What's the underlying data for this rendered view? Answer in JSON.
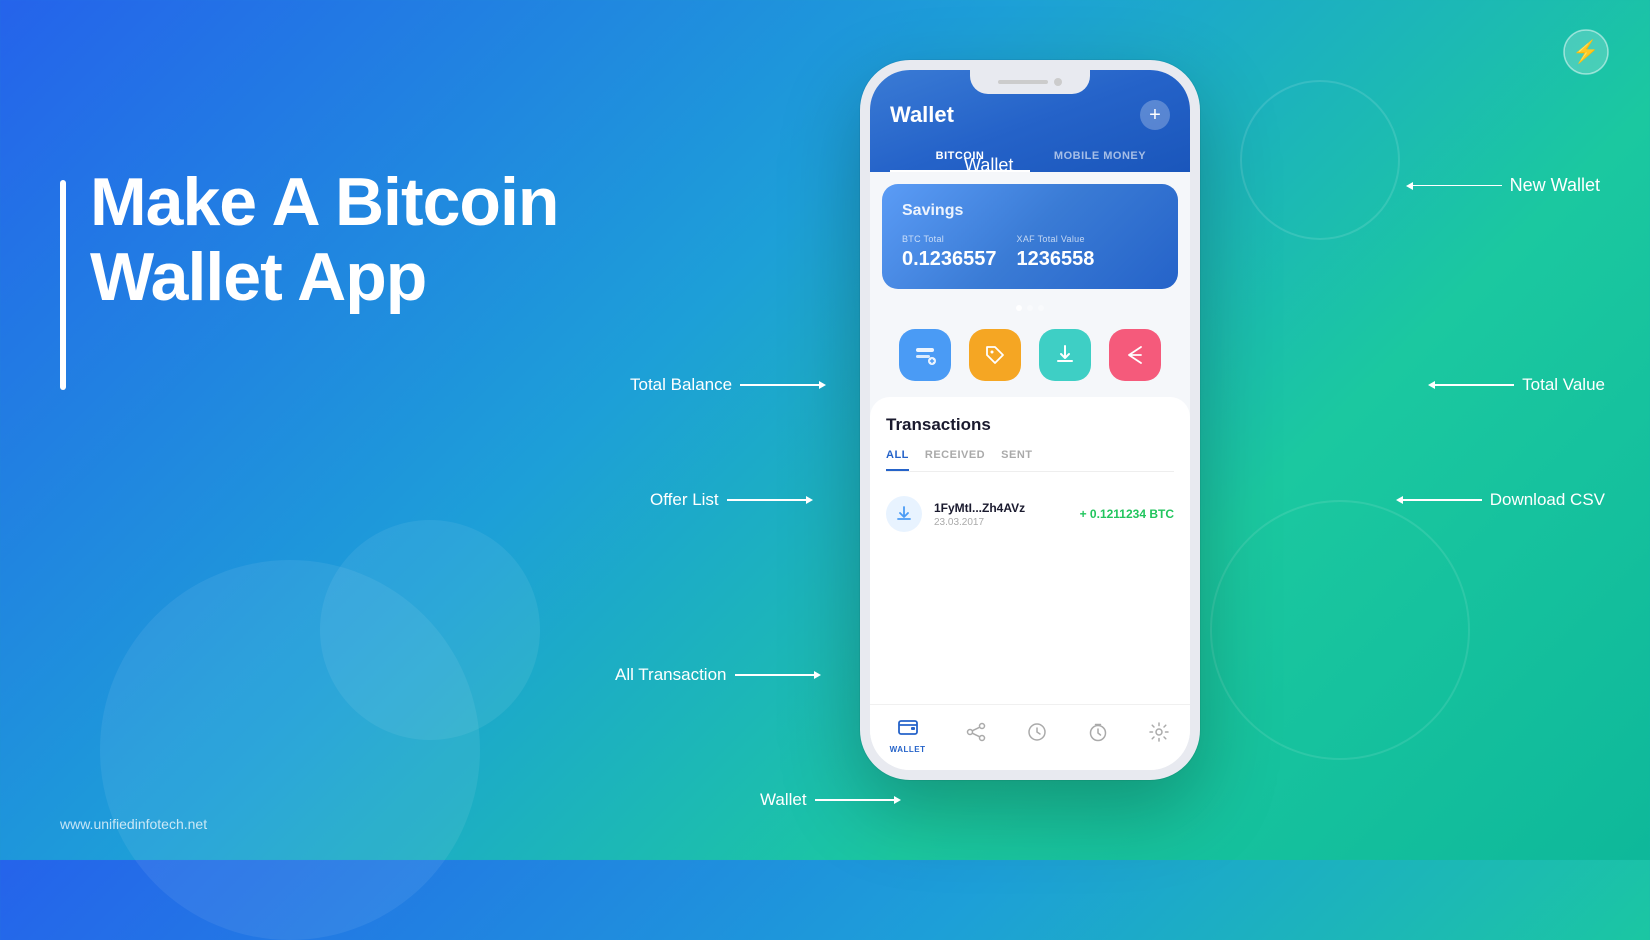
{
  "background": {
    "gradient_start": "#2563eb",
    "gradient_end": "#0eb89a"
  },
  "hero": {
    "title_line1": "Make A Bitcoin",
    "title_line2": "Wallet App",
    "website": "www.unifiedinfotech.net"
  },
  "logo": {
    "icon": "⚡",
    "alt": "Unified Infotech"
  },
  "phone": {
    "header": {
      "title": "Wallet",
      "plus_button": "+",
      "tabs": [
        {
          "label": "BITCOIN",
          "active": true
        },
        {
          "label": "MOBILE MONEY",
          "active": false
        }
      ]
    },
    "savings_card": {
      "label": "Savings",
      "btc_label": "BTC Total",
      "btc_value": "0.1236557",
      "xaf_label": "XAF Total Value",
      "xaf_value": "1236558"
    },
    "action_buttons": [
      {
        "icon": "🛒",
        "color": "blue",
        "label": "offer-list"
      },
      {
        "icon": "🏷",
        "color": "yellow",
        "label": "tag"
      },
      {
        "icon": "⬇",
        "color": "teal",
        "label": "download-csv"
      },
      {
        "icon": "↗",
        "color": "pink",
        "label": "share"
      }
    ],
    "transactions": {
      "title": "Transactions",
      "tabs": [
        {
          "label": "ALL",
          "active": true
        },
        {
          "label": "RECEIVED",
          "active": false
        },
        {
          "label": "SENT",
          "active": false
        }
      ],
      "items": [
        {
          "address": "1FyMtI...Zh4AVz",
          "date": "23.03.2017",
          "amount": "+ 0.1211234 BTC"
        }
      ]
    },
    "bottom_nav": [
      {
        "icon": "👛",
        "label": "WALLET",
        "active": true
      },
      {
        "icon": "↗",
        "label": "",
        "active": false
      },
      {
        "icon": "⏱",
        "label": "",
        "active": false
      },
      {
        "icon": "🕐",
        "label": "",
        "active": false
      },
      {
        "icon": "⚙",
        "label": "",
        "active": false
      }
    ]
  },
  "annotations": {
    "wallet_label": "Wallet",
    "new_wallet": "New Wallet",
    "total_balance": "Total Balance",
    "total_value": "Total Value",
    "offer_list": "Offer List",
    "download_csv": "Download CSV",
    "all_transaction": "All Transaction",
    "wallet_bottom": "Wallet"
  }
}
